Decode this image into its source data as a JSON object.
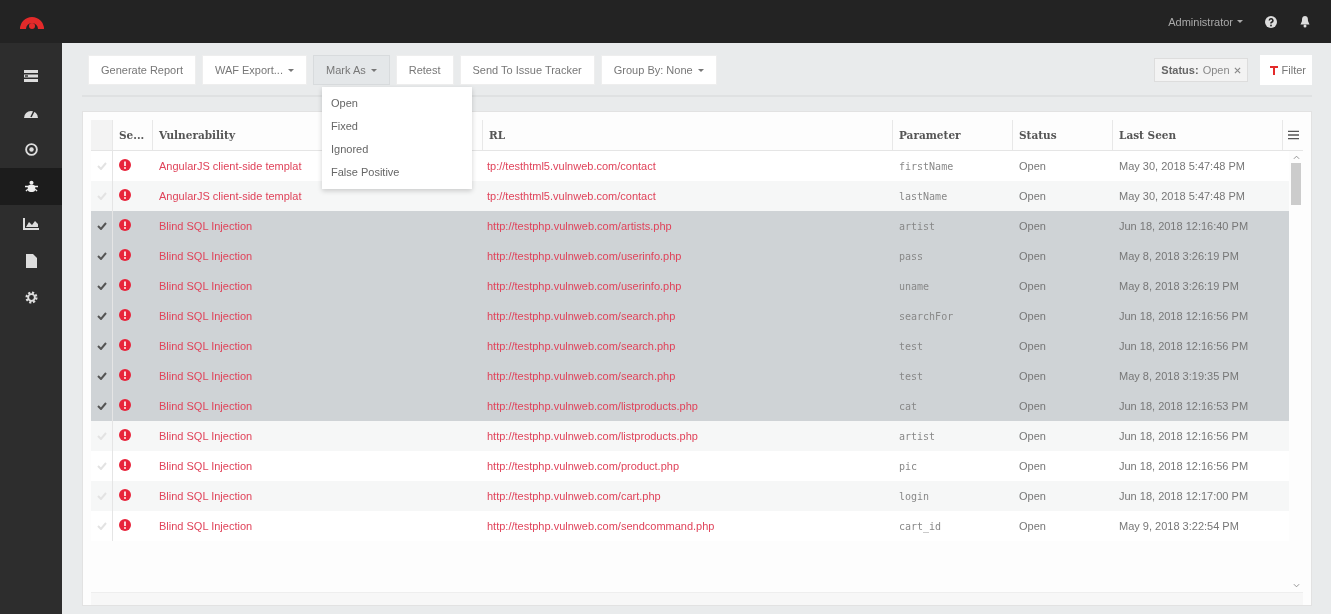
{
  "header": {
    "user_menu": "Administrator"
  },
  "sidebar": {
    "items": [
      {
        "kind": "list",
        "selected": false
      },
      {
        "kind": "gauge",
        "selected": false
      },
      {
        "kind": "target",
        "selected": false
      },
      {
        "kind": "bug",
        "selected": true
      },
      {
        "kind": "chart",
        "selected": false
      },
      {
        "kind": "document",
        "selected": false
      },
      {
        "kind": "gear",
        "selected": false
      }
    ]
  },
  "toolbar": {
    "buttons": [
      {
        "label": "Generate Report",
        "dropdown": false,
        "open": false
      },
      {
        "label": "WAF Export...",
        "dropdown": true,
        "open": false
      },
      {
        "label": "Mark As",
        "dropdown": true,
        "open": true
      },
      {
        "label": "Retest",
        "dropdown": false,
        "open": false
      },
      {
        "label": "Send To Issue Tracker",
        "dropdown": false,
        "open": false
      },
      {
        "label": "Group By: None",
        "dropdown": true,
        "open": false
      }
    ],
    "filter_chip": {
      "key": "Status:",
      "value": "Open"
    },
    "filter_button": "Filter"
  },
  "mark_as_menu": [
    "Open",
    "Fixed",
    "Ignored",
    "False Positive"
  ],
  "table": {
    "columns": [
      "Se...",
      "Vulnerability",
      "RL",
      "Parameter",
      "Status",
      "Last Seen"
    ],
    "rows": [
      {
        "selected": false,
        "vulnerability": "AngularJS client-side templat",
        "url": "tp://testhtml5.vulnweb.com/contact",
        "parameter": "firstName",
        "status": "Open",
        "last_seen": "May 30, 2018 5:47:48 PM"
      },
      {
        "selected": false,
        "vulnerability": "AngularJS client-side templat",
        "url": "tp://testhtml5.vulnweb.com/contact",
        "parameter": "lastName",
        "status": "Open",
        "last_seen": "May 30, 2018 5:47:48 PM"
      },
      {
        "selected": true,
        "vulnerability": "Blind SQL Injection",
        "url": "http://testphp.vulnweb.com/artists.php",
        "parameter": "artist",
        "status": "Open",
        "last_seen": "Jun 18, 2018 12:16:40 PM"
      },
      {
        "selected": true,
        "vulnerability": "Blind SQL Injection",
        "url": "http://testphp.vulnweb.com/userinfo.php",
        "parameter": "pass",
        "status": "Open",
        "last_seen": "May 8, 2018 3:26:19 PM"
      },
      {
        "selected": true,
        "vulnerability": "Blind SQL Injection",
        "url": "http://testphp.vulnweb.com/userinfo.php",
        "parameter": "uname",
        "status": "Open",
        "last_seen": "May 8, 2018 3:26:19 PM"
      },
      {
        "selected": true,
        "vulnerability": "Blind SQL Injection",
        "url": "http://testphp.vulnweb.com/search.php",
        "parameter": "searchFor",
        "status": "Open",
        "last_seen": "Jun 18, 2018 12:16:56 PM"
      },
      {
        "selected": true,
        "vulnerability": "Blind SQL Injection",
        "url": "http://testphp.vulnweb.com/search.php",
        "parameter": "test",
        "status": "Open",
        "last_seen": "Jun 18, 2018 12:16:56 PM"
      },
      {
        "selected": true,
        "vulnerability": "Blind SQL Injection",
        "url": "http://testphp.vulnweb.com/search.php",
        "parameter": "test",
        "status": "Open",
        "last_seen": "May 8, 2018 3:19:35 PM"
      },
      {
        "selected": true,
        "vulnerability": "Blind SQL Injection",
        "url": "http://testphp.vulnweb.com/listproducts.php",
        "parameter": "cat",
        "status": "Open",
        "last_seen": "Jun 18, 2018 12:16:53 PM"
      },
      {
        "selected": false,
        "vulnerability": "Blind SQL Injection",
        "url": "http://testphp.vulnweb.com/listproducts.php",
        "parameter": "artist",
        "status": "Open",
        "last_seen": "Jun 18, 2018 12:16:56 PM"
      },
      {
        "selected": false,
        "vulnerability": "Blind SQL Injection",
        "url": "http://testphp.vulnweb.com/product.php",
        "parameter": "pic",
        "status": "Open",
        "last_seen": "Jun 18, 2018 12:16:56 PM"
      },
      {
        "selected": false,
        "vulnerability": "Blind SQL Injection",
        "url": "http://testphp.vulnweb.com/cart.php",
        "parameter": "login",
        "status": "Open",
        "last_seen": "Jun 18, 2018 12:17:00 PM"
      },
      {
        "selected": false,
        "vulnerability": "Blind SQL Injection",
        "url": "http://testphp.vulnweb.com/sendcommand.php",
        "parameter": "cart_id",
        "status": "Open",
        "last_seen": "May 9, 2018 3:22:54 PM"
      }
    ]
  }
}
